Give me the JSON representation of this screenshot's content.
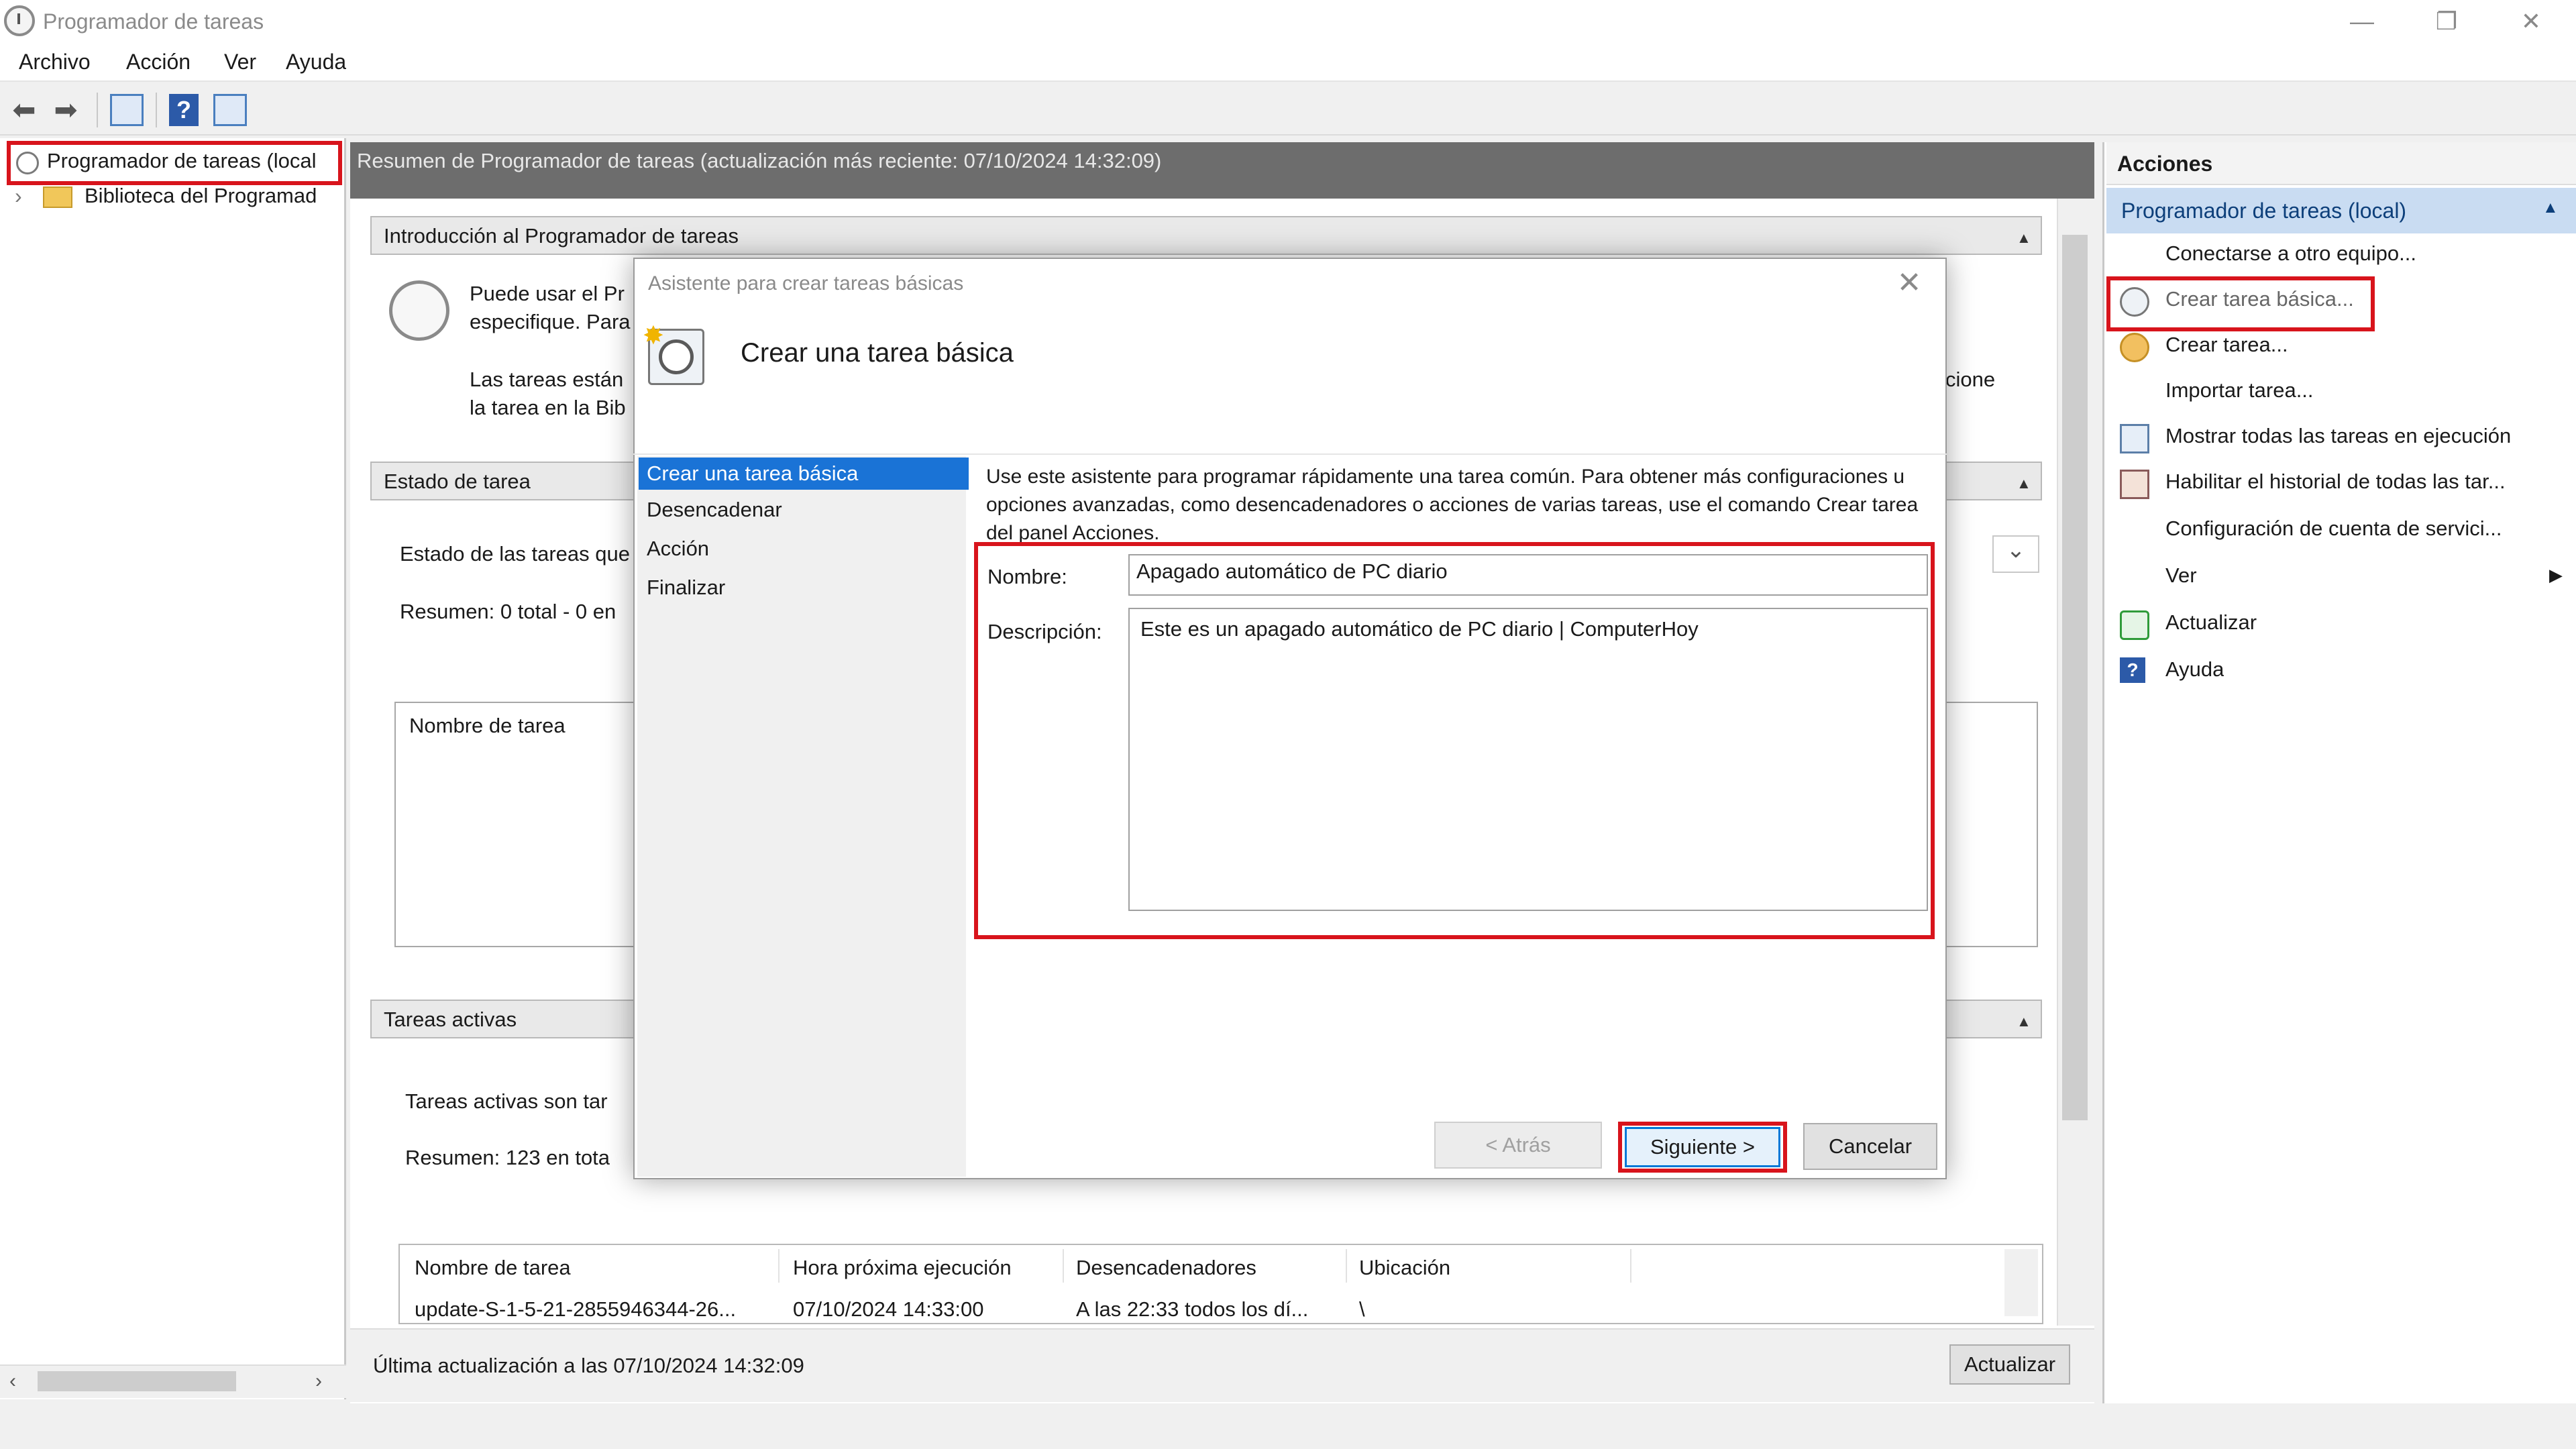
{
  "window": {
    "title": "Programador de tareas",
    "min_glyph": "—",
    "restore_glyph": "❐",
    "close_glyph": "✕"
  },
  "menu": [
    "Archivo",
    "Acción",
    "Ver",
    "Ayuda"
  ],
  "toolbar": {
    "back_glyph": "⬅",
    "forward_glyph": "➡",
    "help_glyph": "?"
  },
  "tree": {
    "root_label": "Programador de tareas (local",
    "child_label": "Biblioteca del Programad",
    "expand_glyph": "›"
  },
  "center": {
    "header": "Resumen de Programador de tareas (actualización más reciente: 07/10/2024 14:32:09)",
    "intro_title": "Introducción al Programador de tareas",
    "intro_line1": "Puede usar el Pr",
    "intro_line2": "especifique. Para",
    "intro_line3": "Las tareas están",
    "intro_line4": "la tarea en la Bib",
    "intro_right_fragment": "cione",
    "status_title": "Estado de tarea",
    "status_line1": "Estado de las tareas que",
    "status_line2": "Resumen: 0 total - 0 en",
    "status_box_header": "Nombre de tarea",
    "active_title": "Tareas activas",
    "active_line1": "Tareas activas son tar",
    "active_line2": "Resumen: 123 en tota",
    "collapse_glyph": "▲",
    "dropdown_glyph": "⌄",
    "table": {
      "columns": [
        "Nombre de tarea",
        "Hora próxima ejecución",
        "Desencadenadores",
        "Ubicación"
      ],
      "rows": [
        [
          "update-S-1-5-21-2855946344-26...",
          "07/10/2024 14:33:00",
          "A las 22:33 todos los dí...",
          "\\"
        ]
      ]
    },
    "last_update": "Última actualización a las 07/10/2024 14:32:09",
    "refresh_label": "Actualizar"
  },
  "actions_pane": {
    "title": "Acciones",
    "group": "Programador de tareas (local)",
    "group_glyph": "▲",
    "items": [
      {
        "label": "Conectarse a otro equipo...",
        "icon": "none"
      },
      {
        "label": "Crear tarea básica...",
        "icon": "basic-task-icon"
      },
      {
        "label": "Crear tarea...",
        "icon": "task-icon"
      },
      {
        "label": "Importar tarea...",
        "icon": "none"
      },
      {
        "label": "Mostrar todas las tareas en ejecución",
        "icon": "running-tasks-icon"
      },
      {
        "label": "Habilitar el historial de todas las tar...",
        "icon": "history-icon"
      },
      {
        "label": "Configuración de cuenta de servici...",
        "icon": "none"
      },
      {
        "label": "Ver",
        "icon": "none"
      },
      {
        "label": "Actualizar",
        "icon": "refresh-icon"
      },
      {
        "label": "Ayuda",
        "icon": "help-icon"
      }
    ],
    "submenu_glyph": "▶"
  },
  "dialog": {
    "title": "Asistente para crear tareas básicas",
    "heading": "Crear una tarea básica",
    "steps": [
      "Crear una tarea básica",
      "Desencadenar",
      "Acción",
      "Finalizar"
    ],
    "description": "Use este asistente para programar rápidamente una tarea común. Para obtener más configuraciones u opciones avanzadas, como desencadenadores o acciones de varias tareas, use el comando Crear tarea del panel Acciones.",
    "name_label": "Nombre:",
    "name_value": "Apagado automático de PC diario",
    "desc_label": "Descripción:",
    "desc_value": "Este es un apagado automático de PC diario | ComputerHoy",
    "back_label": "< Atrás",
    "next_label": "Siguiente >",
    "cancel_label": "Cancelar",
    "close_glyph": "✕"
  },
  "colors": {
    "highlight_red": "#d8141c",
    "selection_blue": "#1a73d6",
    "group_blue": "#c9dcf2"
  }
}
